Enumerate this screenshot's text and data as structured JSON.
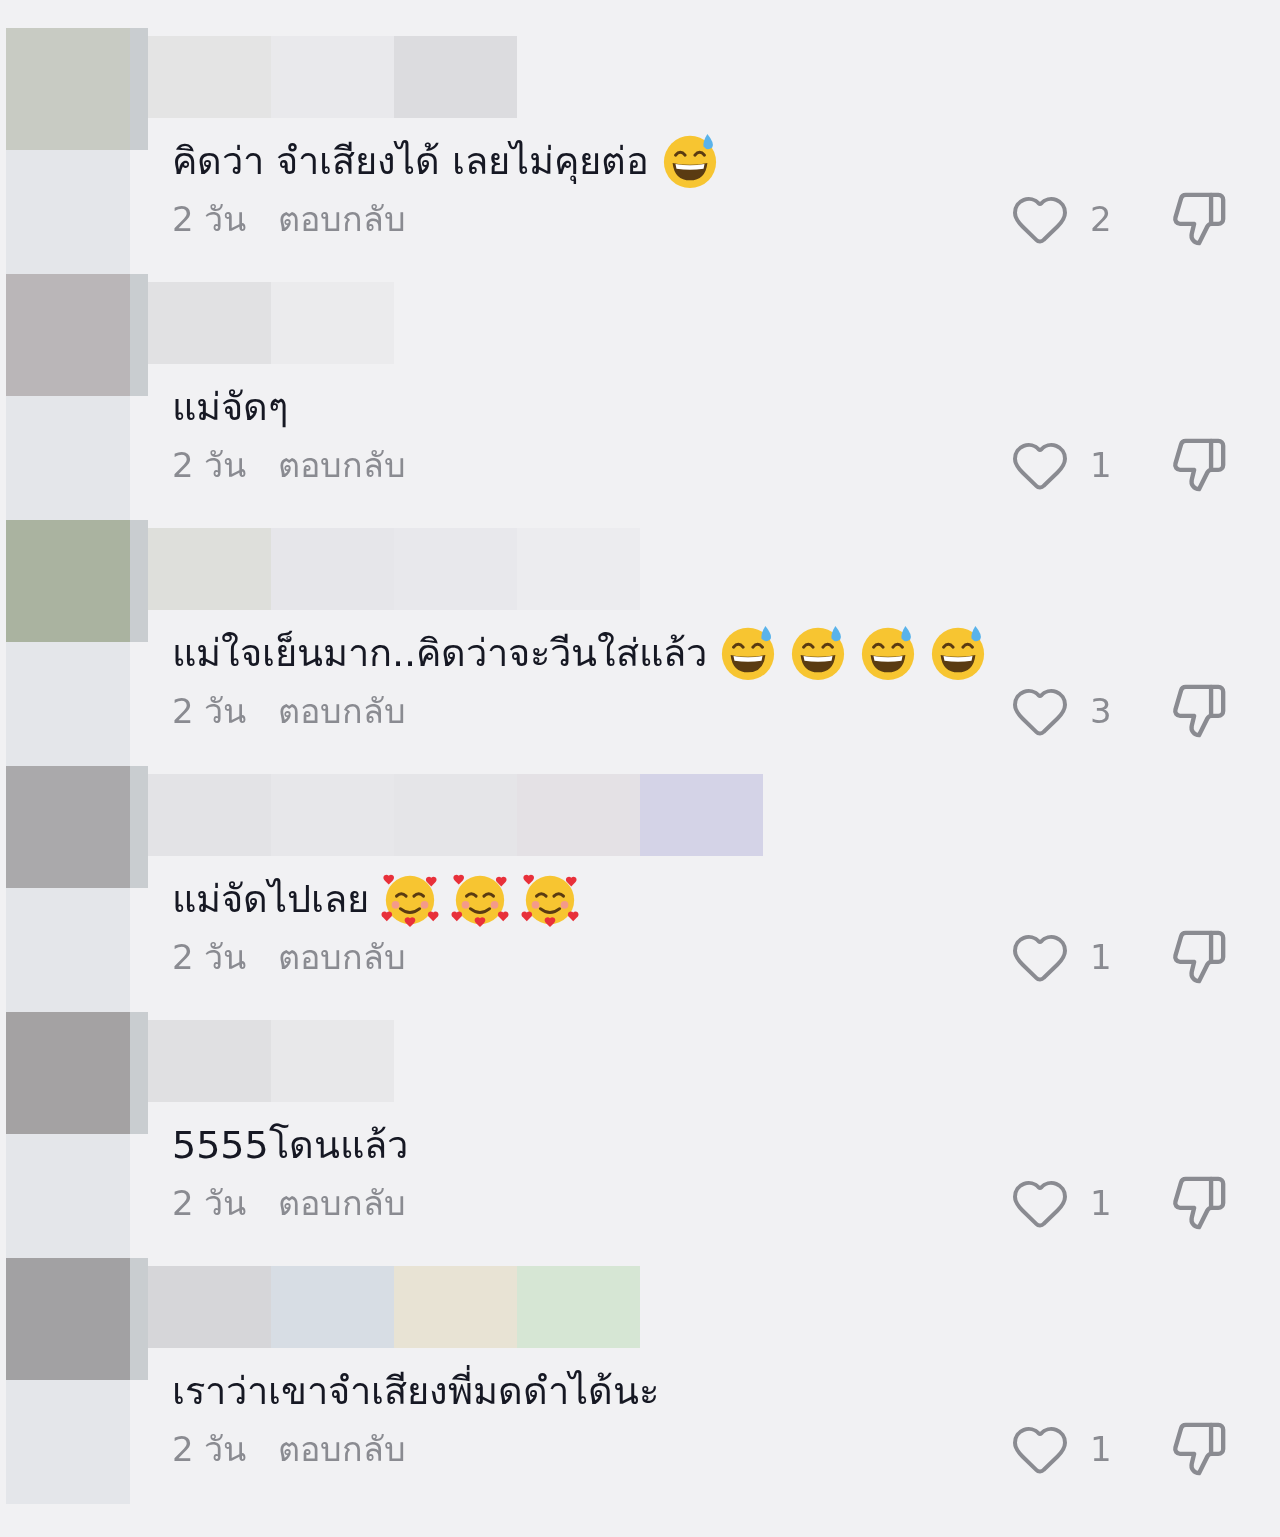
{
  "comments": [
    {
      "text": "คิดว่า จำเสียงได้ เลยไม่คุยต่อ",
      "emojis": [
        {
          "kind": "sweat_smile"
        }
      ],
      "date": "2 วัน",
      "reply": "ตอบกลับ",
      "likes": "2"
    },
    {
      "text": "แม่จัดๆ",
      "date": "2 วัน",
      "reply": "ตอบกลับ",
      "likes": "1"
    },
    {
      "text": "แม่ใจเย็นมาก..คิดว่าจะวีนใส่แล้ว",
      "emojis": [
        {
          "kind": "sweat_smile"
        },
        {
          "kind": "sweat_smile"
        },
        {
          "kind": "sweat_smile"
        },
        {
          "kind": "sweat_smile"
        }
      ],
      "date": "2 วัน",
      "reply": "ตอบกลับ",
      "likes": "3"
    },
    {
      "text": "แม่จัดไปเลย",
      "emojis": [
        {
          "kind": "hearts"
        },
        {
          "kind": "hearts"
        },
        {
          "kind": "hearts"
        }
      ],
      "date": "2 วัน",
      "reply": "ตอบกลับ",
      "likes": "1"
    },
    {
      "text": "5555โดนแล้ว",
      "date": "2 วัน",
      "reply": "ตอบกลับ",
      "likes": "1"
    },
    {
      "text": "เราว่าเขาจำเสียงพี่มดดำได้นะ",
      "date": "2 วัน",
      "reply": "ตอบกลับ",
      "likes": "1"
    }
  ]
}
